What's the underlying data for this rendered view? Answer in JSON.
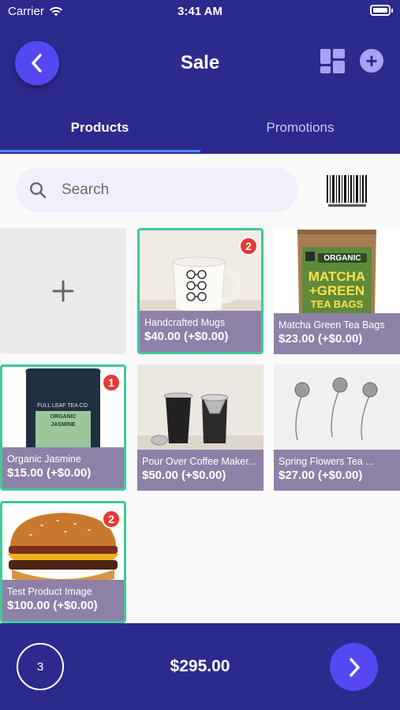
{
  "status_bar": {
    "carrier": "Carrier",
    "time": "3:41 AM"
  },
  "header": {
    "title": "Sale",
    "back_icon": "chevron-left-icon",
    "layout_icon": "dashboard-icon",
    "add_icon": "plus-circle-icon"
  },
  "tabs": [
    {
      "label": "Products",
      "active": true
    },
    {
      "label": "Promotions",
      "active": false
    }
  ],
  "search": {
    "placeholder": "Search"
  },
  "add_tile": {
    "icon": "plus-icon"
  },
  "products": [
    {
      "name": "Handcrafted Mugs",
      "price": "$40.00 (+$0.00)",
      "badge": "2",
      "selected": true
    },
    {
      "name": "Matcha Green Tea Bags",
      "price": "$23.00 (+$0.00)",
      "badge": "",
      "selected": false
    },
    {
      "name": "Organic Jasmine",
      "price": "$15.00 (+$0.00)",
      "badge": "1",
      "selected": true
    },
    {
      "name": "Pour Over Coffee Maker...",
      "price": "$50.00 (+$0.00)",
      "badge": "",
      "selected": false
    },
    {
      "name": "Spring Flowers Tea ...",
      "price": "$27.00 (+$0.00)",
      "badge": "",
      "selected": false
    },
    {
      "name": "Test Product Image",
      "price": "$100.00 (+$0.00)",
      "badge": "2",
      "selected": true
    }
  ],
  "matcha_pack": {
    "brand": "ORGANIC",
    "line1": "MATCHA",
    "line2": "+GREEN",
    "line3": "TEA BAGS"
  },
  "jasmine_pack": {
    "brand": "FULL LEAF TEA CO.",
    "label1": "ORGANIC",
    "label2": "JASMINE"
  },
  "footer": {
    "item_count": "3",
    "total": "$295.00"
  },
  "colors": {
    "primary": "#2d2a8e",
    "accent": "#5548f2",
    "selected": "#3fc99a",
    "badge": "#e53935",
    "caption": "#8e81a7"
  }
}
